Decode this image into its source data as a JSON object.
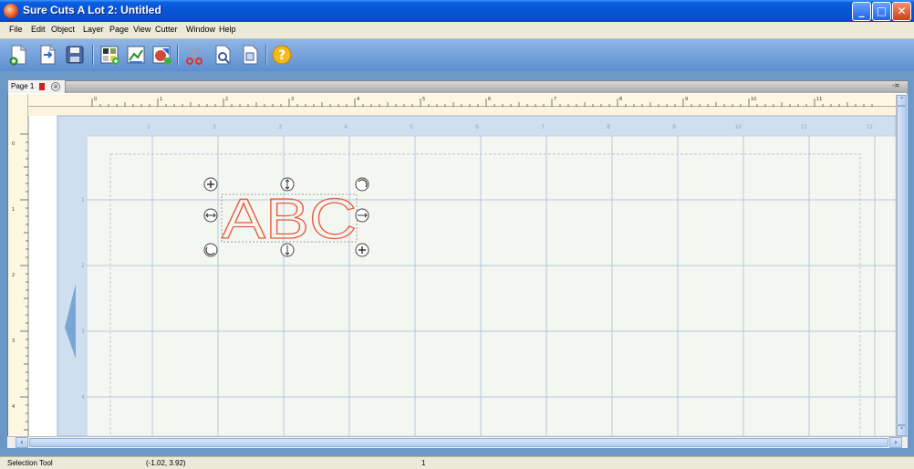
{
  "window": {
    "title": "Sure Cuts A Lot 2: Untitled"
  },
  "menu": [
    {
      "label": "File"
    },
    {
      "label": "Edit"
    },
    {
      "label": "Object"
    },
    {
      "label": "Layer"
    },
    {
      "label": "Page"
    },
    {
      "label": "View"
    },
    {
      "label": "Cutter"
    },
    {
      "label": "Window"
    },
    {
      "label": "Help"
    }
  ],
  "toolbar": {
    "tools": [
      {
        "name": "new-document-icon"
      },
      {
        "name": "open-document-icon"
      },
      {
        "name": "save-icon"
      },
      {
        "name": "import-image-icon"
      },
      {
        "name": "import-chart-icon"
      },
      {
        "name": "import-shape-icon"
      },
      {
        "name": "cut-scissors-icon"
      },
      {
        "name": "preview-icon"
      },
      {
        "name": "print-preview-icon"
      },
      {
        "name": "help-icon"
      }
    ]
  },
  "tab": {
    "label": "Page 1",
    "close_glyph": "⊗",
    "strip_button": "-¤"
  },
  "ruler": {
    "top_labels": [
      "0",
      "1",
      "2",
      "3",
      "4",
      "5",
      "6",
      "7",
      "8",
      "9",
      "10",
      "11"
    ],
    "left_labels": [
      "0",
      "1",
      "2",
      "3",
      "4"
    ]
  },
  "mat": {
    "column_labels": [
      "1",
      "2",
      "3",
      "4",
      "5",
      "6",
      "7",
      "8",
      "9",
      "10",
      "11",
      "12"
    ],
    "row_labels": [
      "1",
      "2",
      "3",
      "4"
    ]
  },
  "design": {
    "text": "ABC",
    "stroke_color": "#e85a3a"
  },
  "scroll": {
    "left": "‹",
    "right": "›",
    "up": "˄",
    "down": "˅"
  },
  "status": {
    "tool": "Selection Tool",
    "coords": "(-1.02, 3.92)",
    "page": "1"
  }
}
